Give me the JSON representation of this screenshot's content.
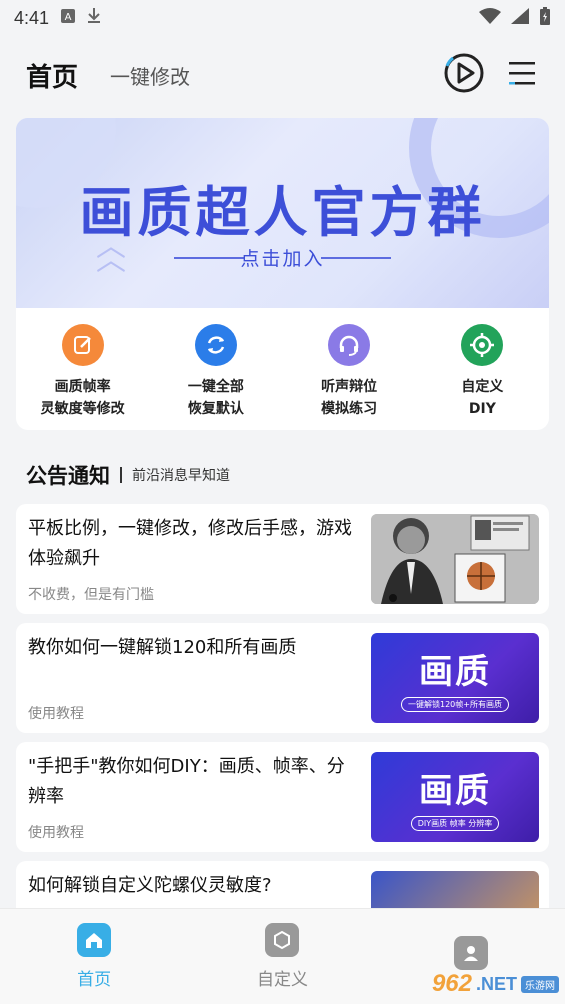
{
  "status_bar": {
    "time": "4:41"
  },
  "header": {
    "title": "首页",
    "subtitle": "一键修改"
  },
  "banner": {
    "title": "画质超人官方群",
    "subtitle": "点击加入"
  },
  "quick_actions": [
    {
      "line1": "画质帧率",
      "line2": "灵敏度等修改",
      "color": "#f5893a",
      "icon": "edit-icon"
    },
    {
      "line1": "一键全部",
      "line2": "恢复默认",
      "color": "#2b7de9",
      "icon": "refresh-icon"
    },
    {
      "line1": "听声辩位",
      "line2": "模拟练习",
      "color": "#8a7ae6",
      "icon": "headset-icon"
    },
    {
      "line1": "自定义",
      "line2": "DIY",
      "color": "#22a35a",
      "icon": "target-icon"
    }
  ],
  "notices": {
    "title": "公告通知",
    "subtitle": "前沿消息早知道"
  },
  "news": [
    {
      "title": "平板比例，一键修改，修改后手感，游戏体验飙升",
      "tag": "不收费，但是有门槛",
      "thumb": "photo"
    },
    {
      "title": "教你如何一键解锁120和所有画质",
      "tag": "使用教程",
      "thumb": "purple",
      "thumb_big": "画质",
      "thumb_small": "一键解锁120帧+所有画质"
    },
    {
      "title": "\"手把手\"教你如何DIY：画质、帧率、分辨率",
      "tag": "使用教程",
      "thumb": "purple",
      "thumb_big": "画质",
      "thumb_small": "DIY画质 帧率 分辨率"
    },
    {
      "title": "如何解锁自定义陀螺仪灵敏度?",
      "tag": "",
      "thumb": "orange"
    }
  ],
  "bottom_nav": [
    {
      "label": "首页",
      "active": true
    },
    {
      "label": "自定义",
      "active": false
    },
    {
      "label": "",
      "active": false
    }
  ],
  "watermark": {
    "num": "962",
    "net": ".NET",
    "site": "乐游网"
  },
  "colors": {
    "accent": "#38aee6",
    "banner_text": "#3d4fd8"
  }
}
